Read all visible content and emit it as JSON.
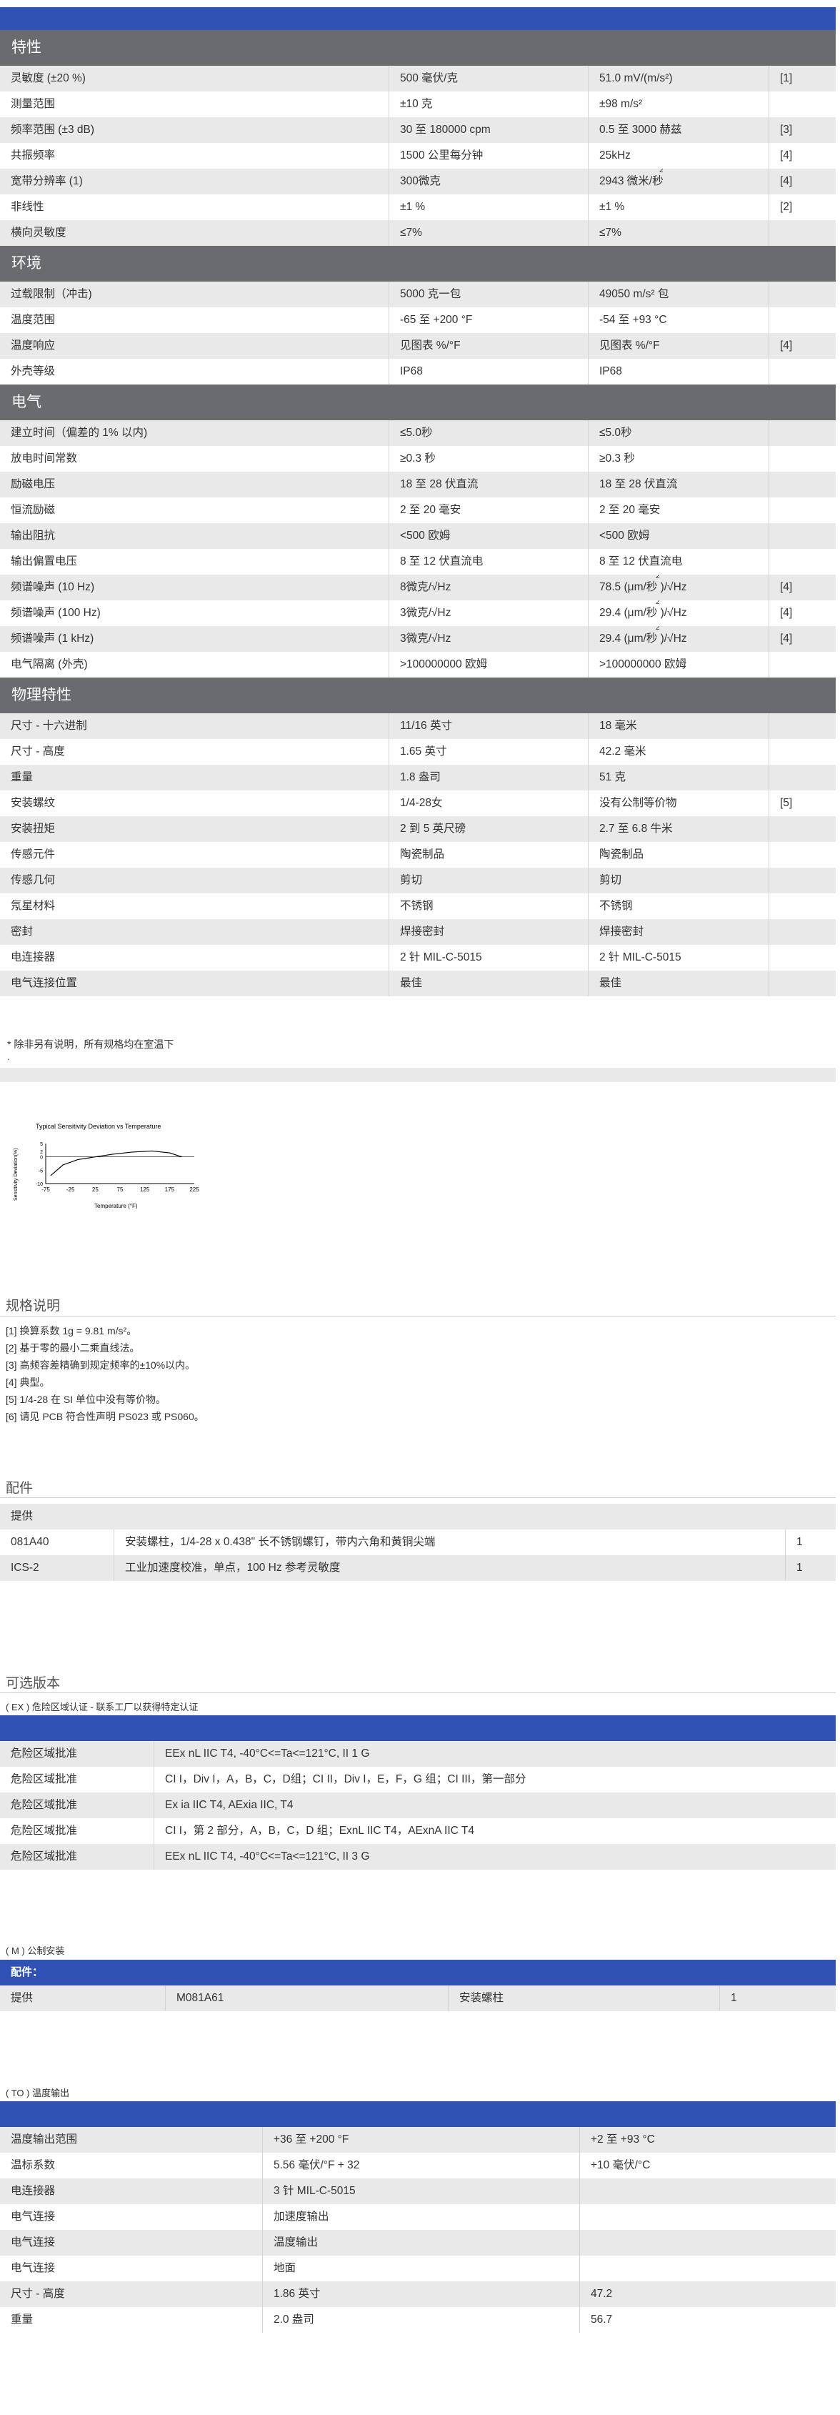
{
  "specs": {
    "sections": [
      {
        "title": "特性",
        "rows": [
          [
            "灵敏度 (±20 %)",
            "500 毫伏/克",
            "51.0 mV/(m/s²)",
            "[1]"
          ],
          [
            "测量范围",
            "±10 克",
            "±98 m/s²",
            ""
          ],
          [
            "频率范围 (±3 dB)",
            "30 至 180000 cpm",
            "0.5 至 3000 赫兹",
            "[3]"
          ],
          [
            "共振频率",
            "1500 公里每分钟",
            "25kHz",
            "[4]"
          ],
          [
            "宽带分辨率 (1)",
            "300微克",
            "2943 微米/秒",
            "[4]"
          ],
          [
            "非线性",
            "±1 %",
            "±1 %",
            "[2]"
          ],
          [
            "横向灵敏度",
            "≤7%",
            "≤7%",
            ""
          ]
        ]
      },
      {
        "title": "环境",
        "rows": [
          [
            "过载限制（冲击)",
            "5000 克一包",
            "49050 m/s² 包",
            ""
          ],
          [
            "温度范围",
            "-65 至 +200 °F",
            "-54 至 +93 °C",
            ""
          ],
          [
            "温度响应",
            "见图表 %/°F",
            "见图表 %/°F",
            "[4]"
          ],
          [
            "外壳等级",
            "IP68",
            "IP68",
            ""
          ]
        ]
      },
      {
        "title": "电气",
        "rows": [
          [
            "建立时间（偏差的 1% 以内)",
            "≤5.0秒",
            "≤5.0秒",
            ""
          ],
          [
            "放电时间常数",
            "≥0.3 秒",
            "≥0.3 秒",
            ""
          ],
          [
            "励磁电压",
            "18 至 28 伏直流",
            "18 至 28 伏直流",
            ""
          ],
          [
            "恒流励磁",
            "2 至 20 毫安",
            "2 至 20 毫安",
            ""
          ],
          [
            "输出阻抗",
            "<500 欧姆",
            "<500 欧姆",
            ""
          ],
          [
            "输出偏置电压",
            "8 至 12 伏直流电",
            "8 至 12 伏直流电",
            ""
          ],
          [
            "频谱噪声 (10 Hz)",
            "8微克/√Hz",
            "78.5 (μm/秒 )/√Hz",
            "[4]"
          ],
          [
            "频谱噪声 (100 Hz)",
            "3微克/√Hz",
            "29.4 (μm/秒 )/√Hz",
            "[4]"
          ],
          [
            "频谱噪声 (1 kHz)",
            "3微克/√Hz",
            "29.4 (μm/秒 )/√Hz",
            "[4]"
          ],
          [
            "电气隔离 (外壳)",
            ">100000000 欧姆",
            ">100000000 欧姆",
            ""
          ]
        ]
      },
      {
        "title": "物理特性",
        "rows": [
          [
            "尺寸 - 十六进制",
            "11/16 英寸",
            "18 毫米",
            ""
          ],
          [
            "尺寸 - 高度",
            "1.65 英寸",
            "42.2 毫米",
            ""
          ],
          [
            "重量",
            "1.8 盎司",
            "51 克",
            ""
          ],
          [
            "安装螺纹",
            "1/4-28女",
            "没有公制等价物",
            "[5]"
          ],
          [
            "安装扭矩",
            "2 到 5 英尺磅",
            "2.7 至 6.8 牛米",
            ""
          ],
          [
            "传感元件",
            "陶瓷制品",
            "陶瓷制品",
            ""
          ],
          [
            "传感几何",
            "剪切",
            "剪切",
            ""
          ],
          [
            "氖星材料",
            "不锈钢",
            "不锈钢",
            ""
          ],
          [
            "密封",
            "焊接密封",
            "焊接密封",
            ""
          ],
          [
            "电连接器",
            "2 针 MIL-C-5015",
            "2 针 MIL-C-5015",
            ""
          ],
          [
            "电气连接位置",
            "最佳",
            "最佳",
            ""
          ]
        ]
      }
    ],
    "superscript": "2"
  },
  "footnote": "* 除非另有说明，所有规格均在室温下",
  "footnote_dot": ".",
  "chart_data": {
    "type": "line",
    "title": "Typical Sensitivity Deviation vs Temperature",
    "xlabel": "Temperature (°F)",
    "ylabel": "Sensitivity Deviation(%)",
    "x_ticks": [
      -75,
      -25,
      25,
      75,
      125,
      175,
      225
    ],
    "y_ticks": [
      5,
      2,
      0,
      -5,
      -10
    ],
    "xlim": [
      -75,
      225
    ],
    "ylim": [
      -10,
      5
    ],
    "series": [
      {
        "x": [
          -65,
          -40,
          -10,
          25,
          60,
          100,
          140,
          175,
          200
        ],
        "y": [
          -7,
          -3,
          -1,
          0,
          1,
          1.8,
          2.2,
          1.5,
          0
        ]
      }
    ]
  },
  "spec_notes": {
    "title": "规格说明",
    "lines": [
      "[1] 换算系数 1g = 9.81 m/s²。",
      "[2] 基于零的最小二乘直线法。",
      "[3] 高频容差精确到规定频率的±10%以内。",
      "[4] 典型。",
      "[5] 1/4-28 在 SI 单位中没有等价物。",
      "[6] 请见 PCB 符合性声明 PS023 或 PS060。"
    ]
  },
  "accessories": {
    "title": "配件",
    "header": "提供",
    "rows": [
      [
        "081A40",
        "安装螺柱，1/4-28 x 0.438\" 长不锈钢螺钉，带内六角和黄铜尖端",
        "1"
      ],
      [
        "ICS-2",
        "工业加速度校准，单点，100 Hz 参考灵敏度",
        "1"
      ]
    ]
  },
  "versions": {
    "title": "可选版本",
    "ex": {
      "title": "( EX ) 危险区域认证 - 联系工厂以获得特定认证",
      "rows": [
        [
          "危险区域批准",
          "EEx nL IIC T4, -40°C<=Ta<=121°C, II 1 G"
        ],
        [
          "危险区域批准",
          "CI I，Div I，A，B，C，D组；CI II，Div I，E，F，G 组；CI III，第一部分"
        ],
        [
          "危险区域批准",
          "Ex ia IIC T4, AExia IIC, T4"
        ],
        [
          "危险区域批准",
          "CI I，第 2 部分，A，B，C，D 组；ExnL IIC T4，AExnA IIC T4"
        ],
        [
          "危险区域批准",
          "EEx nL IIC T4, -40°C<=Ta<=121°C, II 3 G"
        ]
      ]
    },
    "m": {
      "title": "( M ) 公制安装",
      "header": "配件：",
      "row": [
        "提供",
        "M081A61",
        "安装螺柱",
        "1"
      ]
    },
    "to": {
      "title": "( TO ) 温度输出",
      "rows": [
        [
          "温度输出范围",
          "+36 至 +200 °F",
          "+2 至 +93 °C"
        ],
        [
          "温标系数",
          "5.56 毫伏/°F + 32",
          "+10 毫伏/°C"
        ],
        [
          "电连接器",
          "3 针 MIL-C-5015",
          ""
        ],
        [
          "电气连接",
          "加速度输出",
          ""
        ],
        [
          "电气连接",
          "温度输出",
          ""
        ],
        [
          "电气连接",
          "地面",
          ""
        ],
        [
          "尺寸 - 高度",
          "1.86 英寸",
          "47.2"
        ],
        [
          "重量",
          "2.0 盎司",
          "56.7"
        ]
      ]
    }
  },
  "colors": {
    "blue": "#2f52b4",
    "section_gray": "#6a6b6e",
    "row_gray": "#e9e9ea"
  }
}
